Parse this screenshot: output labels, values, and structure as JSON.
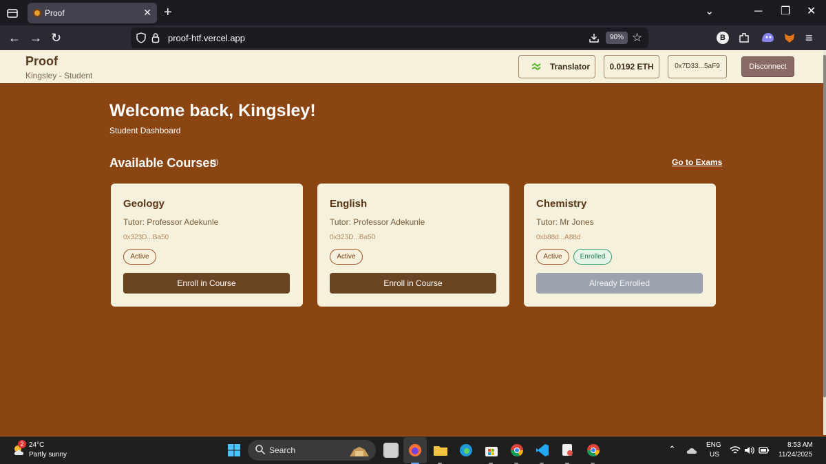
{
  "browser": {
    "tab_title": "Proof",
    "url": "proof-htf.vercel.app",
    "zoom": "90%"
  },
  "header": {
    "brand": "Proof",
    "user": "Kingsley - Student",
    "translator_label": "Translator",
    "eth_balance": "0.0192 ETH",
    "wallet_address": "0x7D33...5aF9",
    "disconnect_label": "Disconnect"
  },
  "main": {
    "welcome": "Welcome back, Kingsley!",
    "subtitle": "Student Dashboard",
    "courses_title": "Available Courses",
    "courses_count": "(3)",
    "exams_link": "Go to Exams"
  },
  "courses": [
    {
      "title": "Geology",
      "tutor": "Tutor: Professor Adekunle",
      "address": "0x323D...Ba50",
      "status": "Active",
      "enrolled_label": "",
      "button": "Enroll in Course"
    },
    {
      "title": "English",
      "tutor": "Tutor: Professor Adekunle",
      "address": "0x323D...Ba50",
      "status": "Active",
      "enrolled_label": "",
      "button": "Enroll in Course"
    },
    {
      "title": "Chemistry",
      "tutor": "Tutor: Mr Jones",
      "address": "0xb88d...A88d",
      "status": "Active",
      "enrolled_label": "Enrolled",
      "button": "Already Enrolled"
    }
  ],
  "taskbar": {
    "weather_badge": "2",
    "temperature": "24°C",
    "weather": "Partly sunny",
    "search_label": "Search",
    "language": "ENG",
    "region": "US",
    "time": "8:53 AM",
    "date": "11/24/2025"
  },
  "colors": {
    "background": "#8B4513",
    "card": "#F5F1DC",
    "primary_button": "#6b4423",
    "disabled_button": "#9ca3af",
    "enrolled": "#2e9d6a"
  }
}
